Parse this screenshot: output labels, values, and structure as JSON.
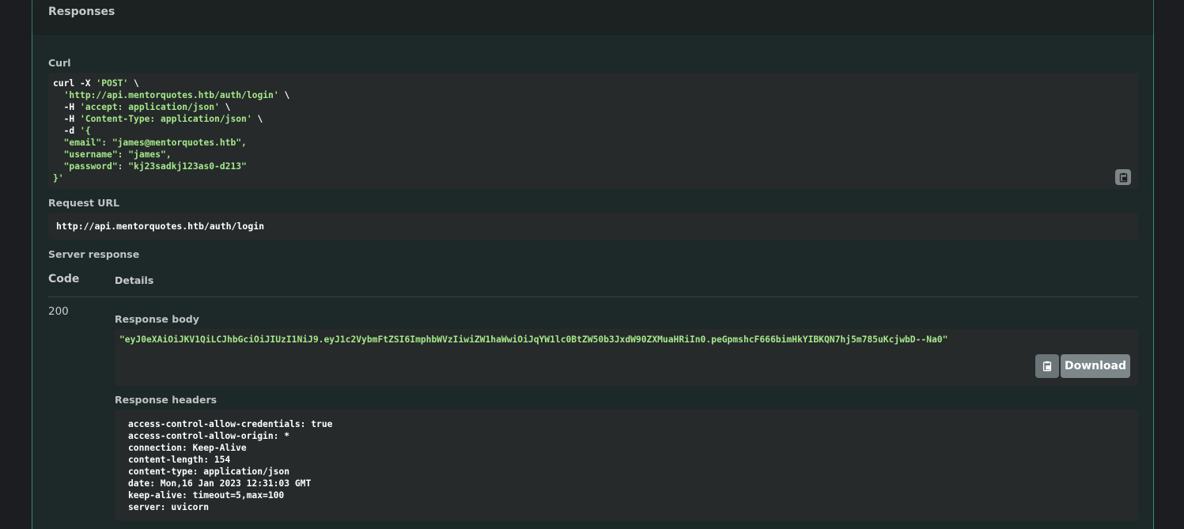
{
  "responses": {
    "title": "Responses"
  },
  "curl": {
    "label": "Curl",
    "lines": [
      {
        "plain": "curl -X ",
        "str": "'POST'",
        "tail": " \\"
      },
      {
        "plain": "  ",
        "str": "'http://api.mentorquotes.htb/auth/login'",
        "tail": " \\"
      },
      {
        "plain": "  -H ",
        "str": "'accept: application/json'",
        "tail": " \\"
      },
      {
        "plain": "  -H ",
        "str": "'Content-Type: application/json'",
        "tail": " \\"
      },
      {
        "plain": "  -d ",
        "str": "'{",
        "tail": ""
      },
      {
        "plain": "  ",
        "str": "\"email\": \"james@mentorquotes.htb\",",
        "tail": ""
      },
      {
        "plain": "  ",
        "str": "\"username\": \"james\",",
        "tail": ""
      },
      {
        "plain": "  ",
        "str": "\"password\": \"kj23sadkj123as0-d213\"",
        "tail": ""
      },
      {
        "plain": "",
        "str": "}'",
        "tail": ""
      }
    ],
    "copy_icon": "clipboard-icon"
  },
  "request_url": {
    "label": "Request URL",
    "value": "http://api.mentorquotes.htb/auth/login"
  },
  "server_response": {
    "label": "Server response",
    "code_header": "Code",
    "details_header": "Details",
    "code": "200",
    "response_body": {
      "label": "Response body",
      "value": "\"eyJ0eXAiOiJKV1QiLCJhbGciOiJIUzI1NiJ9.eyJ1c2VybmFtZSI6ImphbWVzIiwiZW1haWwiOiJqYW1lc0BtZW50b3JxdW90ZXMuaHRiIn0.peGpmshcF666bimHkYIBKQN7hj5m785uKcjwbD--Na0\"",
      "download_label": "Download"
    },
    "response_headers": {
      "label": "Response headers",
      "lines": [
        "access-control-allow-credentials: true",
        "access-control-allow-origin: *",
        "connection: Keep-Alive",
        "content-length: 154",
        "content-type: application/json",
        "date: Mon,16 Jan 2023 12:31:03 GMT",
        "keep-alive: timeout=5,max=100",
        "server: uvicorn"
      ]
    }
  },
  "colors": {
    "panel_bg": "#1d2828",
    "code_bg": "#262a2b",
    "string": "#a5e88a",
    "accent_border": "#3c8a6a"
  }
}
